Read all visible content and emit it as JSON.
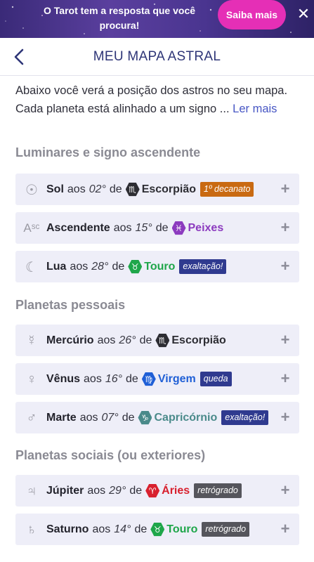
{
  "banner": {
    "text": "O Tarot tem a resposta que você procura!",
    "cta_label": "Saiba mais",
    "close_label": "✕"
  },
  "header": {
    "back_label": "<",
    "title": "MEU MAPA ASTRAL"
  },
  "intro": {
    "text": "Abaixo você verá a posição dos astros no seu mapa. Cada planeta está alinhado a um signo ...",
    "more_label": "Ler mais"
  },
  "sections": [
    {
      "title": "Luminares e signo ascendente",
      "rows": [
        {
          "icon": "sun-icon",
          "glyph": "☉",
          "planet": "Sol",
          "aos": "aos",
          "degree": "02°",
          "de": "de",
          "sign_icon": "scorpio-icon",
          "sign_glyph": "♏",
          "sign": "Escorpião",
          "sign_color": "#2d2d33",
          "tag": "1º decanato",
          "tag_color": "#c96a12"
        },
        {
          "icon": "ascendant-icon",
          "glyph": "Aˢᶜ",
          "planet": "Ascendente",
          "aos": "aos",
          "degree": "15°",
          "de": "de",
          "sign_icon": "pisces-icon",
          "sign_glyph": "♓",
          "sign": "Peixes",
          "sign_color": "#8c3bbf",
          "tag": "",
          "tag_color": ""
        },
        {
          "icon": "moon-icon",
          "glyph": "☾",
          "planet": "Lua",
          "aos": "aos",
          "degree": "28°",
          "de": "de",
          "sign_icon": "taurus-icon",
          "sign_glyph": "♉",
          "sign": "Touro",
          "sign_color": "#1fa64a",
          "tag": "exaltação!",
          "tag_color": "#2f3a8f"
        }
      ]
    },
    {
      "title": "Planetas pessoais",
      "rows": [
        {
          "icon": "mercury-icon",
          "glyph": "☿",
          "planet": "Mercúrio",
          "aos": "aos",
          "degree": "26°",
          "de": "de",
          "sign_icon": "scorpio-icon",
          "sign_glyph": "♏",
          "sign": "Escorpião",
          "sign_color": "#2d2d33",
          "tag": "",
          "tag_color": ""
        },
        {
          "icon": "venus-icon",
          "glyph": "♀",
          "planet": "Vênus",
          "aos": "aos",
          "degree": "16°",
          "de": "de",
          "sign_icon": "virgo-icon",
          "sign_glyph": "♍",
          "sign": "Virgem",
          "sign_color": "#1f5fd6",
          "tag": "queda",
          "tag_color": "#2f3a8f"
        },
        {
          "icon": "mars-icon",
          "glyph": "♂",
          "planet": "Marte",
          "aos": "aos",
          "degree": "07°",
          "de": "de",
          "sign_icon": "capricorn-icon",
          "sign_glyph": "♑",
          "sign": "Capricórnio",
          "sign_color": "#4a8a8a",
          "tag": "exaltação!",
          "tag_color": "#2f3a8f"
        }
      ]
    },
    {
      "title": "Planetas sociais (ou exteriores)",
      "rows": [
        {
          "icon": "jupiter-icon",
          "glyph": "♃",
          "planet": "Júpiter",
          "aos": "aos",
          "degree": "29°",
          "de": "de",
          "sign_icon": "aries-icon",
          "sign_glyph": "♈",
          "sign": "Áries",
          "sign_color": "#d8202e",
          "tag": "retrógrado",
          "tag_color": "#55555c"
        },
        {
          "icon": "saturn-icon",
          "glyph": "♄",
          "planet": "Saturno",
          "aos": "aos",
          "degree": "14°",
          "de": "de",
          "sign_icon": "taurus-icon",
          "sign_glyph": "♉",
          "sign": "Touro",
          "sign_color": "#1fa64a",
          "tag": "retrógrado",
          "tag_color": "#55555c"
        }
      ]
    }
  ],
  "row_action_label": "+",
  "colors": {
    "banner_bg": "#4a3590",
    "banner_cta": "#e52fb6",
    "title": "#2e3577",
    "link": "#4756c4",
    "row_bg": "#eeeef8"
  }
}
